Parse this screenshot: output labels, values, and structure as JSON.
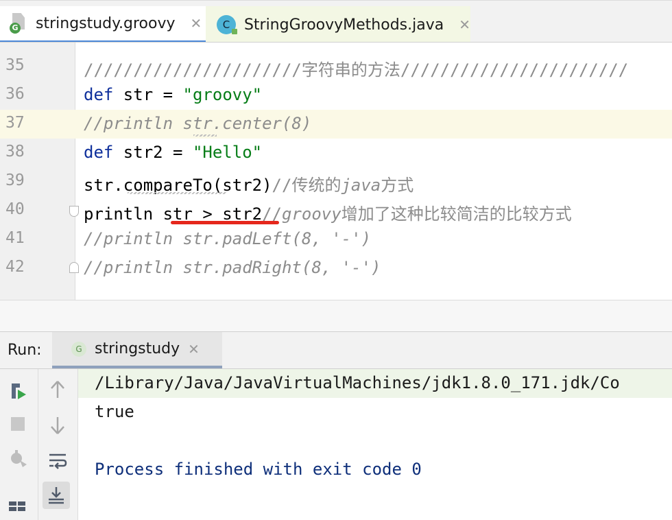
{
  "tabs": [
    {
      "label": "stringstudy.groovy",
      "close": "✕",
      "icon": "groovy-file-icon",
      "active": true
    },
    {
      "label": "StringGroovyMethods.java",
      "close": "✕",
      "icon": "class-icon",
      "icon_letter": "C",
      "active": false
    }
  ],
  "editor": {
    "line_numbers": [
      "35",
      "36",
      "37",
      "38",
      "39",
      "40",
      "41",
      "42"
    ],
    "lines": {
      "l35": "//////////////////////字符串的方法///////////////////////",
      "l36_kw": "def",
      "l36_rest": " str = ",
      "l36_str": "\"groovy\"",
      "l37": "//println str.center(8)",
      "l38_kw": "def",
      "l38_rest": " str2 = ",
      "l38_str": "\"Hello\"",
      "l39_code": "str.compareTo(str2)",
      "l39_cm1": "//传统的",
      "l39_cm2": "java",
      "l39_cm3": "方式",
      "l40_code": "println str > str2",
      "l40_cm1": "//",
      "l40_cm2": "groovy",
      "l40_cm3": "增加了这种比较简洁的比较方式",
      "l41": "//println str.padLeft(8, '-')",
      "l42": "//println str.padRight(8, '-')"
    }
  },
  "run": {
    "label": "Run:",
    "tab_label": "stringstudy",
    "tab_icon_letter": "G",
    "tab_close": "✕",
    "console": {
      "cmd": "/Library/Java/JavaVirtualMachines/jdk1.8.0_171.jdk/Co",
      "output": "true",
      "finish": "Process finished with exit code 0"
    },
    "tools_left": [
      "rerun-icon",
      "stop-icon",
      "debug-settings-icon",
      "layout-icon"
    ],
    "tools_right": [
      "up-arrow-icon",
      "down-arrow-icon",
      "soft-wrap-icon",
      "scroll-to-end-icon"
    ]
  },
  "colors": {
    "keyword": "#0e2f9b",
    "string": "#067d17",
    "comment": "#8c8c8c",
    "accent": "#4d89d9",
    "underline": "#e5271c"
  }
}
